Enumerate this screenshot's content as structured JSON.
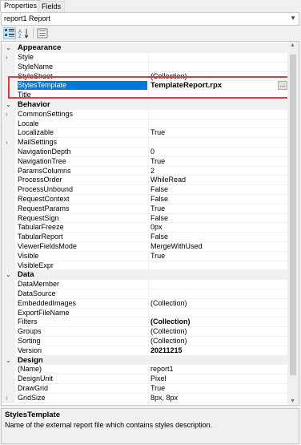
{
  "tabs": [
    {
      "label": "Properties",
      "active": true
    },
    {
      "label": "Fields",
      "active": false
    }
  ],
  "object_selector": {
    "value": "report1 Report"
  },
  "toolbar": {
    "categorized_icon": "categorized-icon",
    "alphabetical_icon": "alphabetical-icon",
    "property_pages_icon": "property-pages-icon"
  },
  "categories": [
    {
      "label": "Appearance",
      "rows": [
        {
          "name": "Style",
          "value": "",
          "expandable": true
        },
        {
          "name": "StyleName",
          "value": ""
        },
        {
          "name": "StyleSheet",
          "value": "(Collection)"
        },
        {
          "name": "StylesTemplate",
          "value": "TemplateReport.rpx",
          "selected": true
        },
        {
          "name": "Title",
          "value": ""
        }
      ]
    },
    {
      "label": "Behavior",
      "rows": [
        {
          "name": "CommonSettings",
          "value": "",
          "expandable": true
        },
        {
          "name": "Locale",
          "value": ""
        },
        {
          "name": "Localizable",
          "value": "True"
        },
        {
          "name": "MailSettings",
          "value": "",
          "expandable": true
        },
        {
          "name": "NavigationDepth",
          "value": "0"
        },
        {
          "name": "NavigationTree",
          "value": "True"
        },
        {
          "name": "ParamsColumns",
          "value": "2"
        },
        {
          "name": "ProcessOrder",
          "value": "WhileRead"
        },
        {
          "name": "ProcessUnbound",
          "value": "False"
        },
        {
          "name": "RequestContext",
          "value": "False"
        },
        {
          "name": "RequestParams",
          "value": "True"
        },
        {
          "name": "RequestSign",
          "value": "False"
        },
        {
          "name": "TabularFreeze",
          "value": "0px"
        },
        {
          "name": "TabularReport",
          "value": "False"
        },
        {
          "name": "ViewerFieldsMode",
          "value": "MergeWithUsed"
        },
        {
          "name": "Visible",
          "value": "True"
        },
        {
          "name": "VisibleExpr",
          "value": ""
        }
      ]
    },
    {
      "label": "Data",
      "rows": [
        {
          "name": "DataMember",
          "value": ""
        },
        {
          "name": "DataSource",
          "value": ""
        },
        {
          "name": "EmbeddedImages",
          "value": "(Collection)"
        },
        {
          "name": "ExportFileName",
          "value": ""
        },
        {
          "name": "Filters",
          "value": "(Collection)",
          "bold": true
        },
        {
          "name": "Groups",
          "value": "(Collection)"
        },
        {
          "name": "Sorting",
          "value": "(Collection)"
        },
        {
          "name": "Version",
          "value": "20211215",
          "bold": true
        }
      ]
    },
    {
      "label": "Design",
      "rows": [
        {
          "name": "(Name)",
          "value": "report1"
        },
        {
          "name": "DesignUnit",
          "value": "Pixel"
        },
        {
          "name": "DrawGrid",
          "value": "True"
        },
        {
          "name": "GridSize",
          "value": "8px, 8px",
          "expandable": true
        }
      ]
    }
  ],
  "ellipsis_label": "...",
  "description": {
    "title": "StylesTemplate",
    "text": "Name of the external report file which contains styles description."
  }
}
